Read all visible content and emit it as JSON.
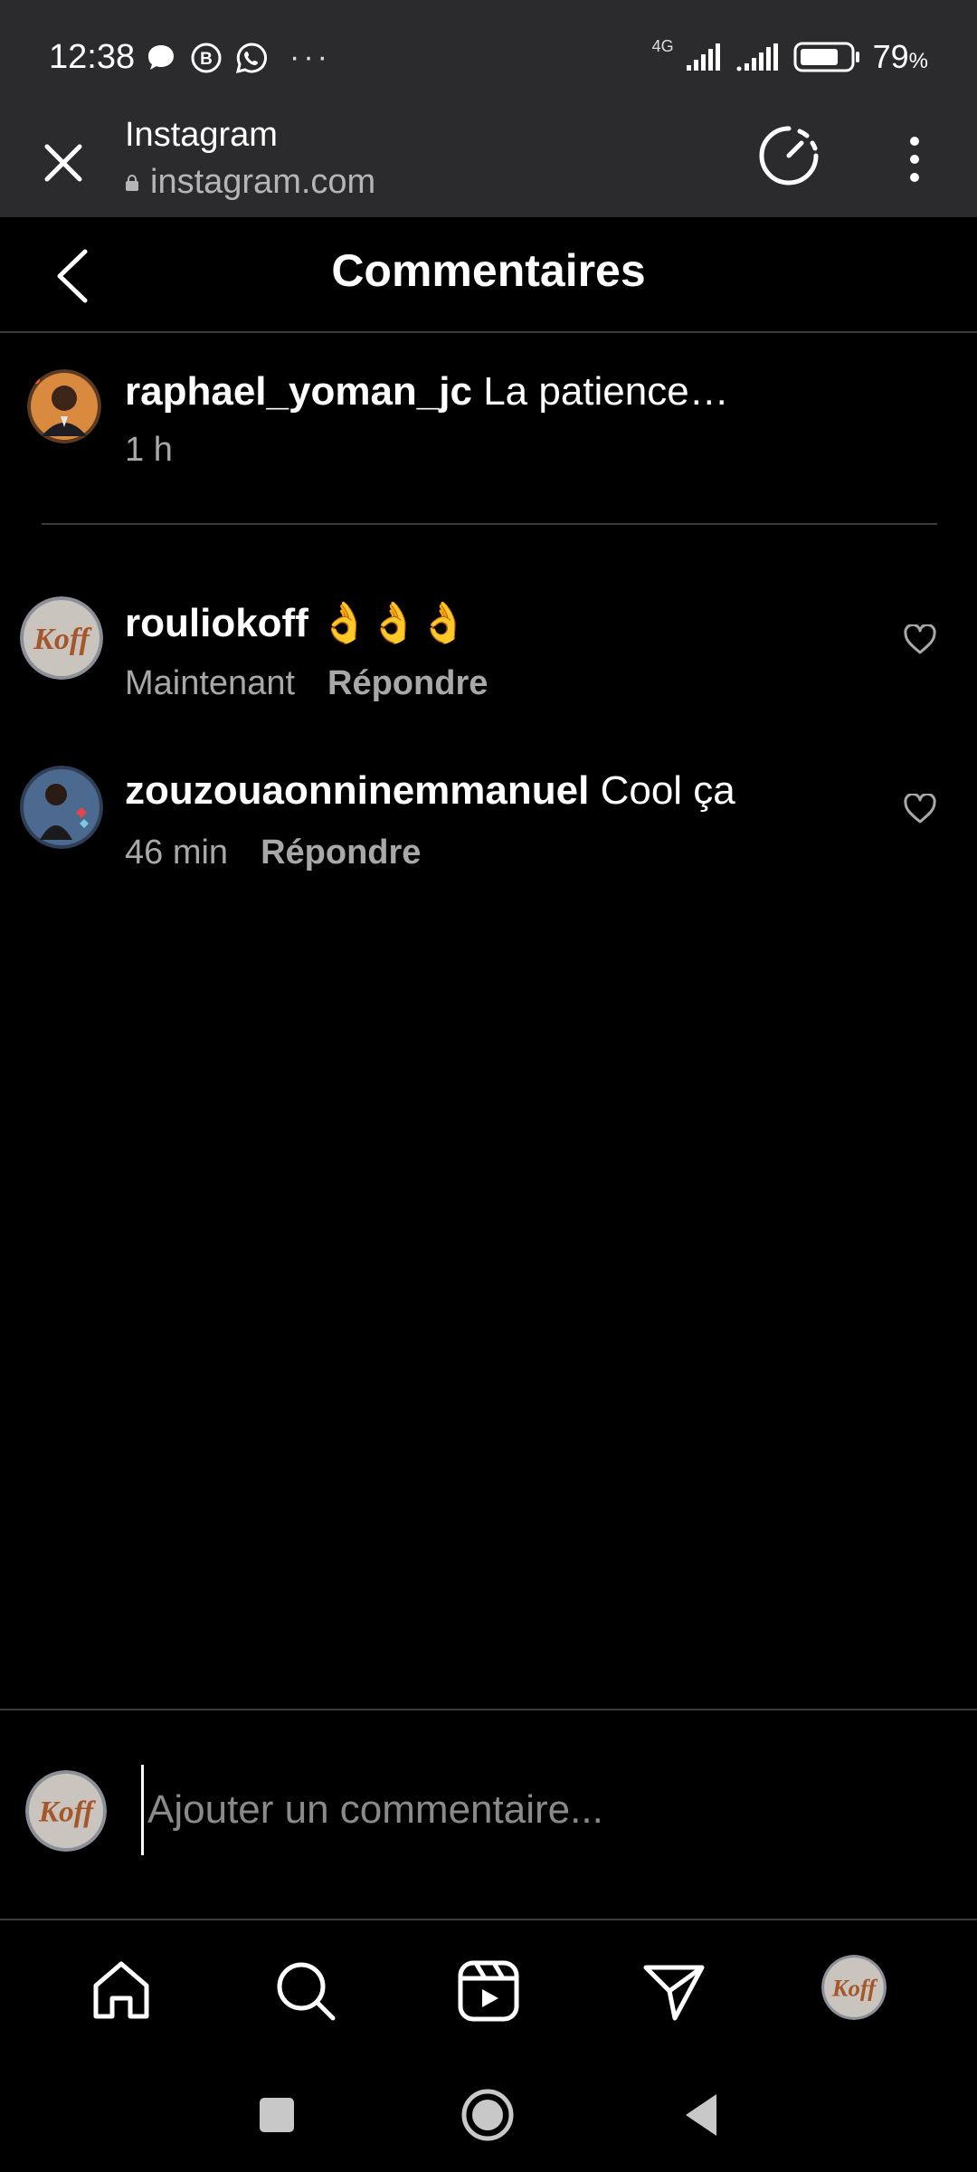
{
  "status_bar": {
    "time": "12:38",
    "network_label": "4G",
    "battery_percent": "79",
    "battery_percent_sign": "%",
    "battery_level": 0.79,
    "notification_icons": [
      "chat-bubble-icon",
      "b-badge-icon",
      "whatsapp-icon"
    ],
    "more_indicator": "···"
  },
  "browser": {
    "title": "Instagram",
    "url": "instagram.com"
  },
  "header": {
    "title": "Commentaires"
  },
  "caption": {
    "username": "raphael_yoman_jc",
    "text": "La patience…",
    "time": "1 h"
  },
  "comments": [
    {
      "username": "rouliokoff",
      "text": "👌👌👌",
      "time": "Maintenant",
      "reply_label": "Répondre"
    },
    {
      "username": "zouzouaonninemmanuel",
      "text": "Cool ça",
      "time": "46 min",
      "reply_label": "Répondre"
    }
  ],
  "input": {
    "placeholder": "Ajouter un commentaire..."
  },
  "colors": {
    "background": "#000000",
    "chrome_bar": "#2b2b2d",
    "muted_text": "#a8a8a8",
    "divider": "#3a3a3a"
  }
}
